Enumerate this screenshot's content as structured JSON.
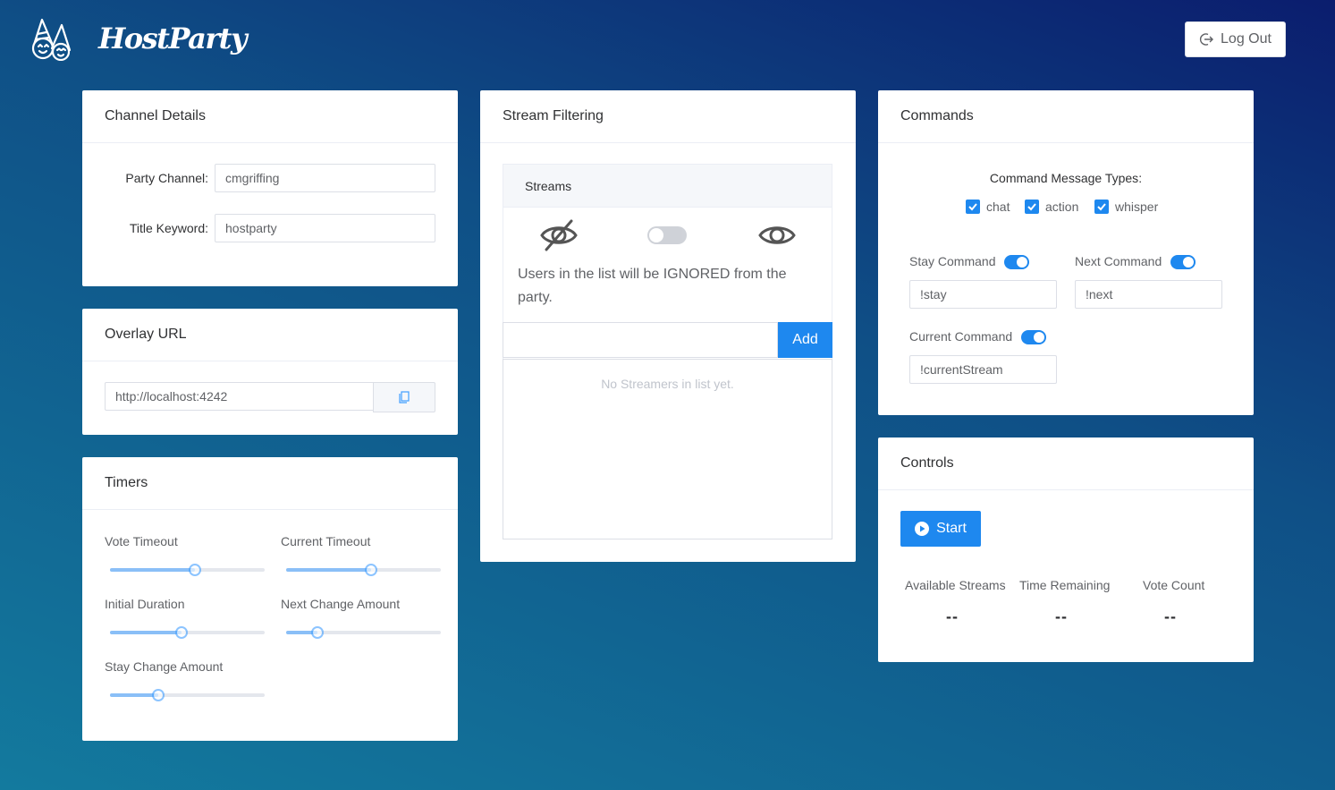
{
  "app": {
    "name": "HostParty",
    "logout_label": "Log Out"
  },
  "channel_details": {
    "title": "Channel Details",
    "party_channel_label": "Party Channel",
    "party_channel_value": "cmgriffing",
    "title_keyword_label": "Title Keyword",
    "title_keyword_value": "hostparty"
  },
  "overlay": {
    "title": "Overlay URL",
    "url": "http://localhost:4242",
    "copy_icon": "copy-icon"
  },
  "timers": {
    "title": "Timers",
    "sliders": [
      {
        "label": "Vote Timeout",
        "percent": 55
      },
      {
        "label": "Current Timeout",
        "percent": 55
      },
      {
        "label": "Initial Duration",
        "percent": 46
      },
      {
        "label": "Next Change Amount",
        "percent": 20
      },
      {
        "label": "Stay Change Amount",
        "percent": 31
      }
    ]
  },
  "stream_filtering": {
    "title": "Stream Filtering",
    "streams_label": "Streams",
    "mode_text": "Users in the list will be IGNORED from the party.",
    "add_label": "Add",
    "input_value": "",
    "empty_text": "No Streamers in list yet.",
    "mode_toggle_on": false,
    "icons": {
      "left": "eye-off-icon",
      "right": "eye-icon"
    }
  },
  "commands": {
    "title": "Commands",
    "types_label": "Command Message Types",
    "types": [
      {
        "label": "chat",
        "checked": true
      },
      {
        "label": "action",
        "checked": true
      },
      {
        "label": "whisper",
        "checked": true
      }
    ],
    "stay": {
      "label": "Stay Command",
      "value": "!stay",
      "enabled": true
    },
    "next": {
      "label": "Next Command",
      "value": "!next",
      "enabled": true
    },
    "current": {
      "label": "Current Command",
      "value": "!currentStream",
      "enabled": true
    }
  },
  "controls": {
    "title": "Controls",
    "start_label": "Start",
    "stats": [
      {
        "label": "Available Streams",
        "value": "--"
      },
      {
        "label": "Time Remaining",
        "value": "--"
      },
      {
        "label": "Vote Count",
        "value": "--"
      }
    ]
  },
  "colors": {
    "primary": "#1e88ef",
    "bg_dark": "#0b1d6e",
    "bg_light": "#137a9e"
  }
}
